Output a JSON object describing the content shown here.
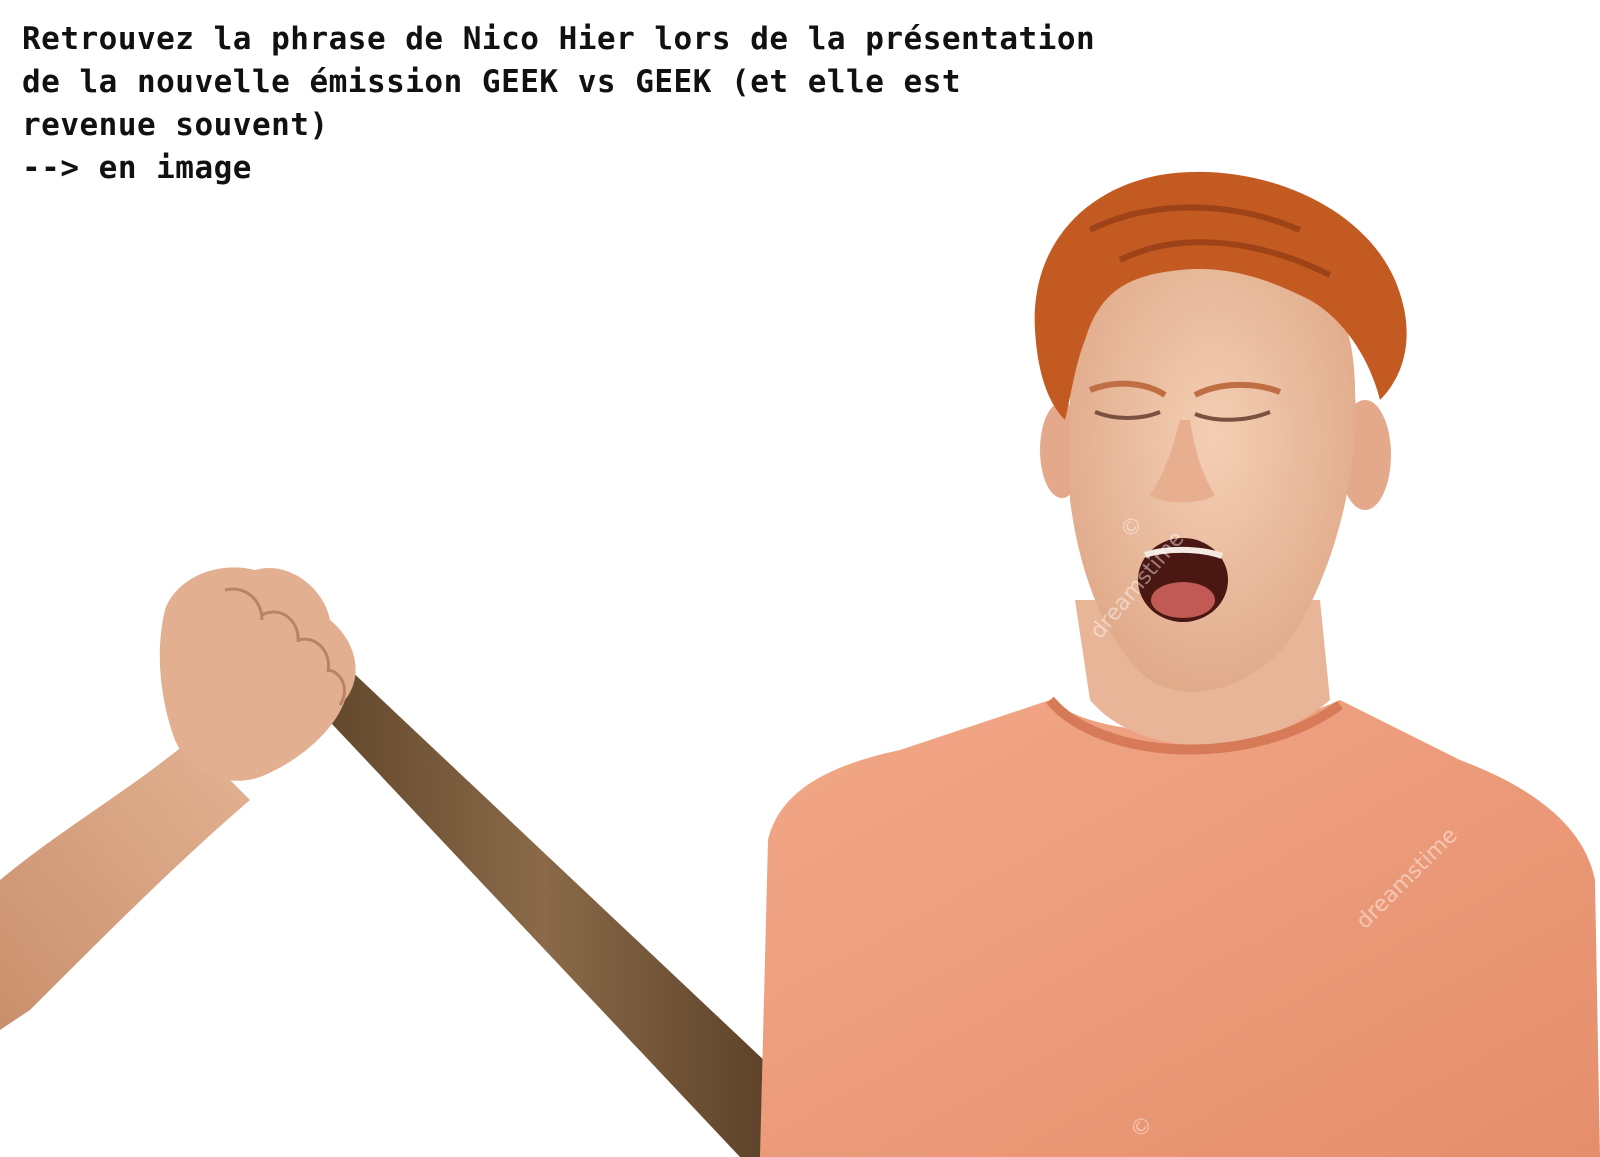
{
  "caption": {
    "lines": [
      "Retrouvez la phrase de Nico Hier lors de la présentation",
      "de la nouvelle émission GEEK vs GEEK (et elle est",
      "revenue souvent)",
      "--> en image"
    ]
  },
  "watermarks": {
    "face": "©",
    "chest": "dreamstime",
    "neck": "dreamstime",
    "bottom": "©"
  },
  "colors": {
    "background": "#ffffff",
    "text": "#111111",
    "hair": "#c25a22",
    "skin": "#efc3a4",
    "shirt": "#ee9f7e",
    "stick": "#7a5a3a",
    "arm": "#d9a582"
  }
}
